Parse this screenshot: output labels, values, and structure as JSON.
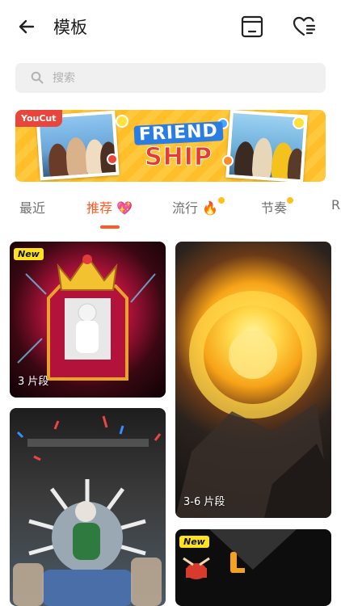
{
  "header": {
    "title": "模板",
    "back_icon": "back-arrow-icon",
    "drafts_icon": "drafts-box-icon",
    "favorites_icon": "heart-list-icon"
  },
  "search": {
    "placeholder": "搜索",
    "icon": "search-icon"
  },
  "banner": {
    "brand": "YouCut",
    "line1": "FRIEND",
    "line2": "SHIP",
    "background_color": "#ffc83d"
  },
  "tabs": [
    {
      "label": "最近",
      "active": false,
      "has_dot": false
    },
    {
      "label": "推荐 💖",
      "active": true,
      "has_dot": false
    },
    {
      "label": "流行 🔥",
      "active": false,
      "has_dot": true
    },
    {
      "label": "节奏",
      "active": false,
      "has_dot": true
    },
    {
      "label": "R",
      "active": false,
      "has_dot": false
    }
  ],
  "accent_color": "#ff5a25",
  "templates": [
    {
      "badge": "New",
      "clips": "3 片段"
    },
    {
      "badge": "",
      "clips": "3-6 片段"
    },
    {
      "badge": "",
      "clips": ""
    },
    {
      "badge": "New",
      "clips": ""
    }
  ]
}
